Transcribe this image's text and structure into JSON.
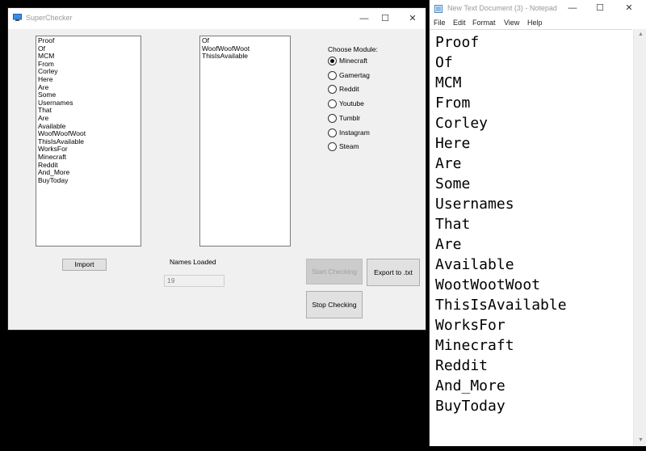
{
  "superchecker": {
    "title": "SuperChecker",
    "input_list": [
      "Proof",
      "Of",
      "MCM",
      "From",
      "Corley",
      "Here",
      "Are",
      "Some",
      "Usernames",
      "That",
      "Are",
      "Available",
      "WoofWoofWoot",
      "ThisIsAvailable",
      "WorksFor",
      "Minecraft",
      "Reddit",
      "And_More",
      "BuyToday"
    ],
    "result_list": [
      "Of",
      "WoofWoofWoot",
      "ThisIsAvailable"
    ],
    "choose_module_label": "Choose Module:",
    "modules": [
      "Minecraft",
      "Gamertag",
      "Reddit",
      "Youtube",
      "Tumblr",
      "Instagram",
      "Steam"
    ],
    "selected_module": "Minecraft",
    "import_label": "Import",
    "names_loaded_label": "Names Loaded",
    "names_loaded_value": "19",
    "start_checking_label": "Start Checking",
    "export_label": "Export to .txt",
    "stop_checking_label": "Stop Checking"
  },
  "notepad": {
    "title": "New Text Document (3) - Notepad",
    "menu": [
      "File",
      "Edit",
      "Format",
      "View",
      "Help"
    ],
    "lines": [
      "Proof",
      "Of",
      "MCM",
      "From",
      "Corley",
      "Here",
      "Are",
      "Some",
      "Usernames",
      "That",
      "Are",
      "Available",
      "WootWootWoot",
      "ThisIsAvailable",
      "WorksFor",
      "Minecraft",
      "Reddit",
      "And_More",
      "BuyToday"
    ]
  },
  "caption": {
    "minimize": "—",
    "maximize": "☐",
    "close": "✕"
  }
}
